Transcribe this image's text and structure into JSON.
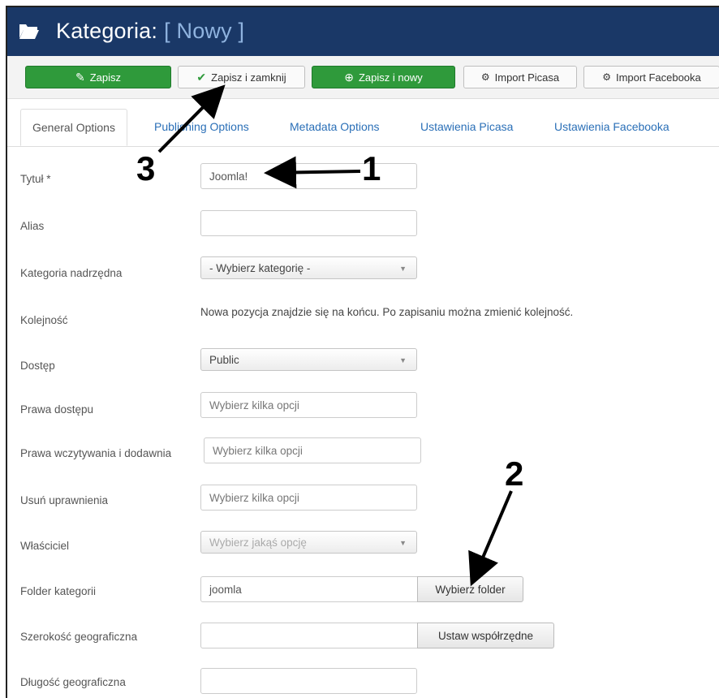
{
  "title": {
    "main": "Kategoria:",
    "sub": "[ Nowy ]"
  },
  "toolbar": {
    "save": "Zapisz",
    "save_close": "Zapisz i zamknij",
    "save_new": "Zapisz i nowy",
    "import_picasa": "Import Picasa",
    "import_facebook": "Import Facebooka"
  },
  "tabs": [
    "General Options",
    "Publishing Options",
    "Metadata Options",
    "Ustawienia Picasa",
    "Ustawienia Facebooka"
  ],
  "form": {
    "title_label": "Tytuł *",
    "title_value": "Joomla!",
    "alias_label": "Alias",
    "alias_value": "",
    "parent_label": "Kategoria nadrzędna",
    "parent_value": "- Wybierz kategorię -",
    "order_label": "Kolejność",
    "order_note": "Nowa pozycja znajdzie się na końcu. Po zapisaniu można zmienić kolejność.",
    "access_label": "Dostęp",
    "access_value": "Public",
    "rights_label": "Prawa dostępu",
    "rights_placeholder": "Wybierz kilka opcji",
    "upload_label": "Prawa wczytywania i dodawnia",
    "upload_placeholder": "Wybierz kilka opcji",
    "delete_label": "Usuń uprawnienia",
    "delete_placeholder": "Wybierz kilka opcji",
    "owner_label": "Właściciel",
    "owner_placeholder": "Wybierz jakąś opcję",
    "folder_label": "Folder kategorii",
    "folder_value": "joomla",
    "folder_button": "Wybierz folder",
    "lat_label": "Szerokość geograficzna",
    "lat_value": "",
    "lat_button": "Ustaw współrzędne",
    "lng_label": "Długość geograficzna",
    "lng_value": ""
  },
  "annotations": {
    "one": "1",
    "two": "2",
    "three": "3"
  },
  "colors": {
    "header": "#1a3867",
    "green": "#2f9a3b",
    "link": "#2a6fb7"
  },
  "icons": {
    "title": "folder-open-icon",
    "save": "edit-icon",
    "save_close": "check-icon",
    "save_new": "plus-circle-icon",
    "import": "user-import-icon"
  }
}
